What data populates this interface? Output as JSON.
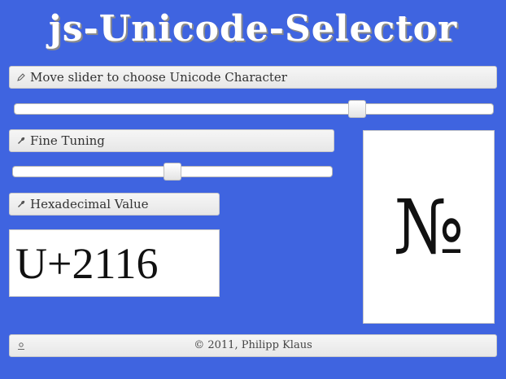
{
  "header": {
    "title": "js-Unicode-Selector"
  },
  "main_slider": {
    "label": "Move slider to choose Unicode Character",
    "icon": "pencil-icon",
    "position": 0.725
  },
  "fine_tuning": {
    "label": "Fine Tuning",
    "icon": "wrench-icon",
    "position": 0.5
  },
  "hex": {
    "label": "Hexadecimal Value",
    "icon": "wrench-icon",
    "value": "U+2116"
  },
  "preview": {
    "character": "№"
  },
  "footer": {
    "icon": "user-icon",
    "text": "© 2011, Philipp Klaus"
  },
  "colors": {
    "background": "#3f64e0",
    "panel": "#f2f2f2"
  }
}
